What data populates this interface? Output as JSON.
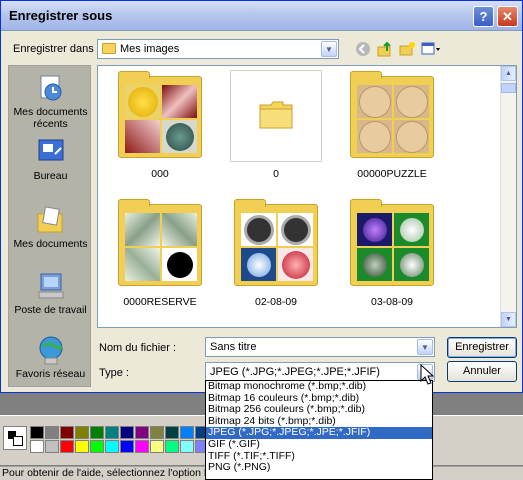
{
  "dialog": {
    "title": "Enregistrer sous",
    "help_glyph": "?",
    "close_glyph": "✕",
    "save_in_label": "Enregistrer dans :",
    "save_in_value": "Mes images",
    "file_name_label": "Nom du fichier :",
    "file_name_value": "Sans titre",
    "type_label": "Type :",
    "type_value": "JPEG (*.JPG;*.JPEG;*.JPE;*.JFIF)",
    "save_button": "Enregistrer",
    "cancel_button": "Annuler"
  },
  "places": [
    {
      "label": "Mes documents récents",
      "icon": "recent-documents-icon"
    },
    {
      "label": "Bureau",
      "icon": "desktop-icon"
    },
    {
      "label": "Mes documents",
      "icon": "my-documents-icon"
    },
    {
      "label": "Poste de travail",
      "icon": "my-computer-icon"
    },
    {
      "label": "Favoris réseau",
      "icon": "network-places-icon"
    }
  ],
  "files": [
    {
      "label": "000"
    },
    {
      "label": "0"
    },
    {
      "label": "00000PUZZLE"
    },
    {
      "label": "0000RESERVE"
    },
    {
      "label": "02-08-09"
    },
    {
      "label": "03-08-09"
    }
  ],
  "type_options": [
    "Bitmap monochrome (*.bmp;*.dib)",
    "Bitmap 16 couleurs (*.bmp;*.dib)",
    "Bitmap 256 couleurs (*.bmp;*.dib)",
    "Bitmap 24 bits (*.bmp;*.dib)",
    "JPEG (*.JPG;*.JPEG;*.JPE;*.JFIF)",
    "GIF (*.GIF)",
    "TIFF (*.TIF;*.TIFF)",
    "PNG (*.PNG)"
  ],
  "selected_type_index": 4,
  "status_text": "Pour obtenir de l'aide, sélectionnez l'option Rubriques d'aide dans le menu d'aide.",
  "palette_colors": [
    "#000000",
    "#808080",
    "#800000",
    "#808000",
    "#008000",
    "#008080",
    "#000080",
    "#800080",
    "#808040",
    "#004040",
    "#0080ff",
    "#004080",
    "#8000ff",
    "#804000",
    "#ffffff",
    "#c0c0c0",
    "#ff0000",
    "#ffff00",
    "#00ff00",
    "#00ffff",
    "#0000ff",
    "#ff00ff",
    "#ffff80",
    "#00ff80",
    "#80ffff",
    "#8080ff",
    "#ff0080",
    "#ff8040"
  ]
}
